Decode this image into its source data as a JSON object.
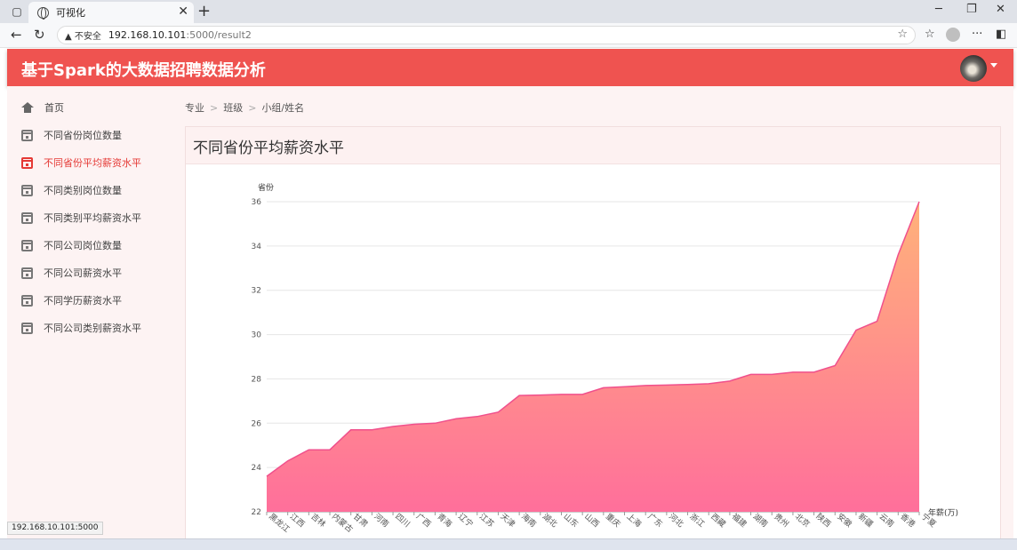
{
  "browser": {
    "tab_title": "可视化",
    "insecure_label": "不安全",
    "url_host": "192.168.10.101",
    "url_rest": ":5000/result2",
    "status_url": "192.168.10.101:5000"
  },
  "app": {
    "title": "基于Spark的大数据招聘数据分析"
  },
  "sidebar": {
    "items": [
      {
        "label": "首页",
        "icon": "home-icon"
      },
      {
        "label": "不同省份岗位数量",
        "icon": "calendar-icon"
      },
      {
        "label": "不同省份平均薪资水平",
        "icon": "calendar-icon",
        "active": true
      },
      {
        "label": "不同类别岗位数量",
        "icon": "calendar-icon"
      },
      {
        "label": "不同类别平均薪资水平",
        "icon": "calendar-icon"
      },
      {
        "label": "不同公司岗位数量",
        "icon": "calendar-icon"
      },
      {
        "label": "不同公司薪资水平",
        "icon": "calendar-icon"
      },
      {
        "label": "不同学历薪资水平",
        "icon": "calendar-icon"
      },
      {
        "label": "不同公司类别薪资水平",
        "icon": "calendar-icon"
      }
    ]
  },
  "breadcrumb": [
    "专业",
    "班级",
    "小组/姓名"
  ],
  "card": {
    "title": "不同省份平均薪资水平"
  },
  "colors": {
    "accent": "#ef5350",
    "area_top": "#ffb27a",
    "area_bottom": "#ff6f9b",
    "line": "#f0508c"
  },
  "chart_data": {
    "type": "area",
    "ylabel": "省份",
    "xlabel": "年薪(万)",
    "ylim": [
      22,
      36
    ],
    "yticks": [
      22,
      24,
      26,
      28,
      30,
      32,
      34,
      36
    ],
    "categories": [
      "黑龙江",
      "江西",
      "吉林",
      "内蒙古",
      "甘肃",
      "河南",
      "四川",
      "广西",
      "青海",
      "辽宁",
      "江苏",
      "天津",
      "海南",
      "湖北",
      "山东",
      "山西",
      "重庆",
      "上海",
      "广东",
      "河北",
      "浙江",
      "西藏",
      "福建",
      "湖南",
      "贵州",
      "北京",
      "陕西",
      "安徽",
      "新疆",
      "云南",
      "香港",
      "宁夏"
    ],
    "values": [
      23.6,
      24.3,
      24.8,
      24.8,
      25.7,
      25.7,
      25.85,
      25.95,
      26.0,
      26.2,
      26.3,
      26.5,
      27.25,
      27.27,
      27.3,
      27.3,
      27.6,
      27.65,
      27.7,
      27.72,
      27.75,
      27.78,
      27.9,
      28.2,
      28.2,
      28.3,
      28.3,
      28.6,
      30.2,
      30.6,
      33.6,
      36.0
    ]
  }
}
